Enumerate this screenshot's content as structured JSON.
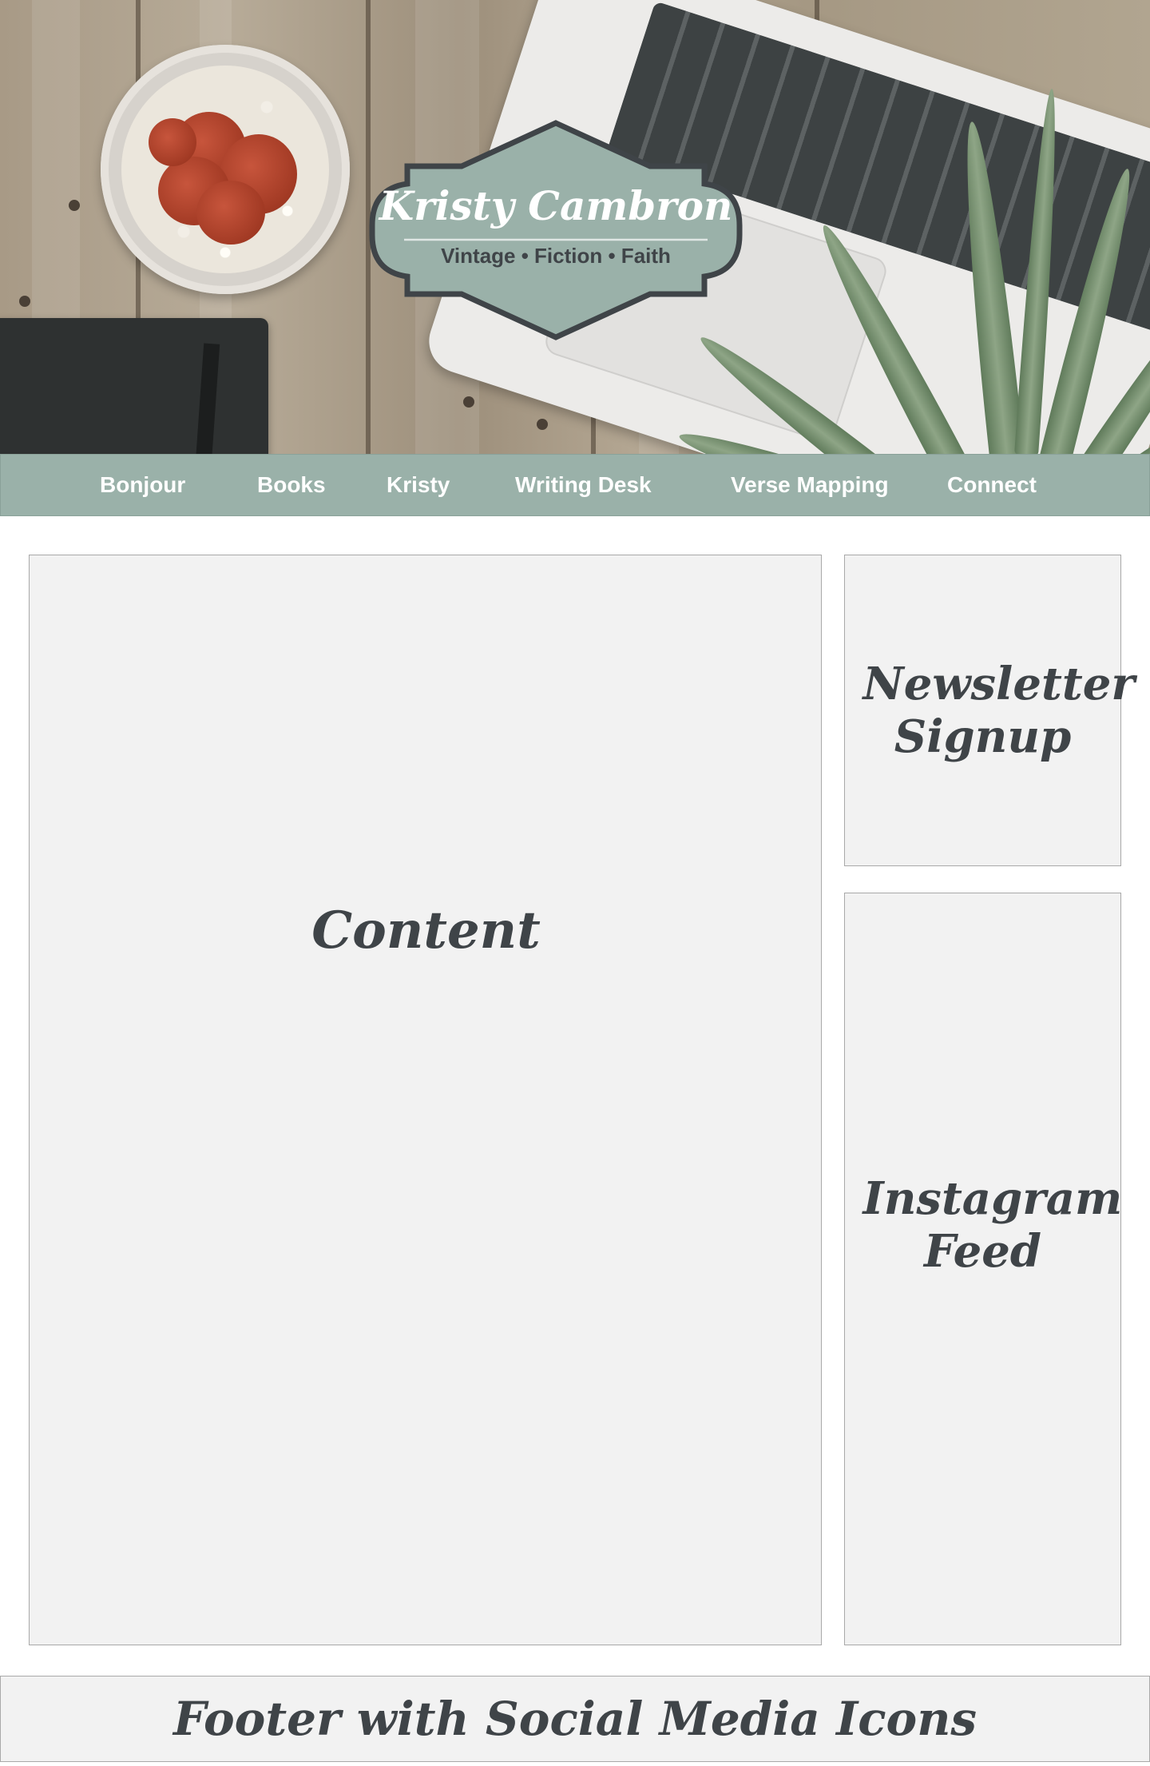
{
  "header": {
    "brand": {
      "title": "Kristy Cambron",
      "tagline": "Vintage • Fiction • Faith"
    }
  },
  "nav": {
    "items": [
      {
        "label": "Bonjour"
      },
      {
        "label": "Books"
      },
      {
        "label": "Kristy"
      },
      {
        "label": "Writing Desk"
      },
      {
        "label": "Verse Mapping"
      },
      {
        "label": "Connect"
      }
    ]
  },
  "main": {
    "content_label": "Content"
  },
  "sidebar": {
    "newsletter_label": "Newsletter Signup",
    "instagram_label": "Instagram Feed"
  },
  "footer": {
    "label": "Footer with Social Media Icons"
  },
  "colors": {
    "nav_bg": "#9ab1a9",
    "badge_fill": "#9ab1a9",
    "badge_border": "#3f4448",
    "placeholder_bg": "#f2f2f2",
    "text_dark": "#3f4448"
  }
}
